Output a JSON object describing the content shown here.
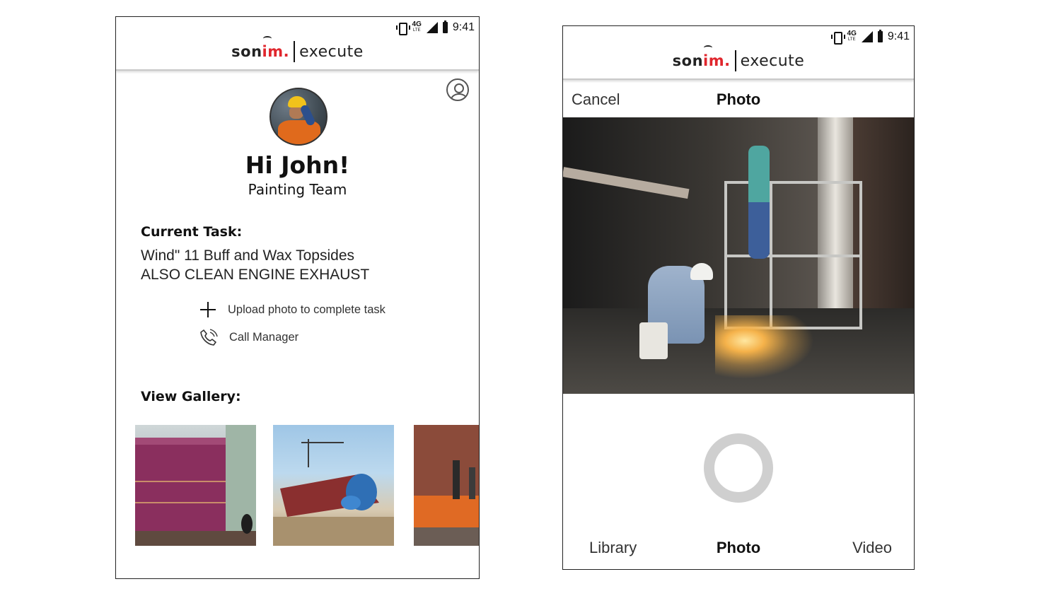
{
  "status_bar": {
    "network": "4G",
    "network_sub": "LTE",
    "time": "9:41"
  },
  "brand": {
    "name_part1": "son",
    "name_part2": "im.",
    "product": "execute",
    "accent_color": "#e0262d"
  },
  "home": {
    "greeting": "Hi John!",
    "team": "Painting Team",
    "current_task_label": "Current Task:",
    "task_line_1": "Wind\" 11 Buff and Wax Topsides",
    "task_line_2": "ALSO CLEAN ENGINE EXHAUST",
    "actions": {
      "upload_label": "Upload photo to complete task",
      "call_label": "Call Manager"
    },
    "gallery_label": "View Gallery:",
    "icons": {
      "profile": "user-circle-icon",
      "upload": "plus-icon",
      "call": "phone-icon"
    }
  },
  "camera": {
    "cancel_label": "Cancel",
    "title": "Photo",
    "modes": {
      "library": "Library",
      "photo": "Photo",
      "video": "Video"
    },
    "selected_mode": "Photo"
  }
}
